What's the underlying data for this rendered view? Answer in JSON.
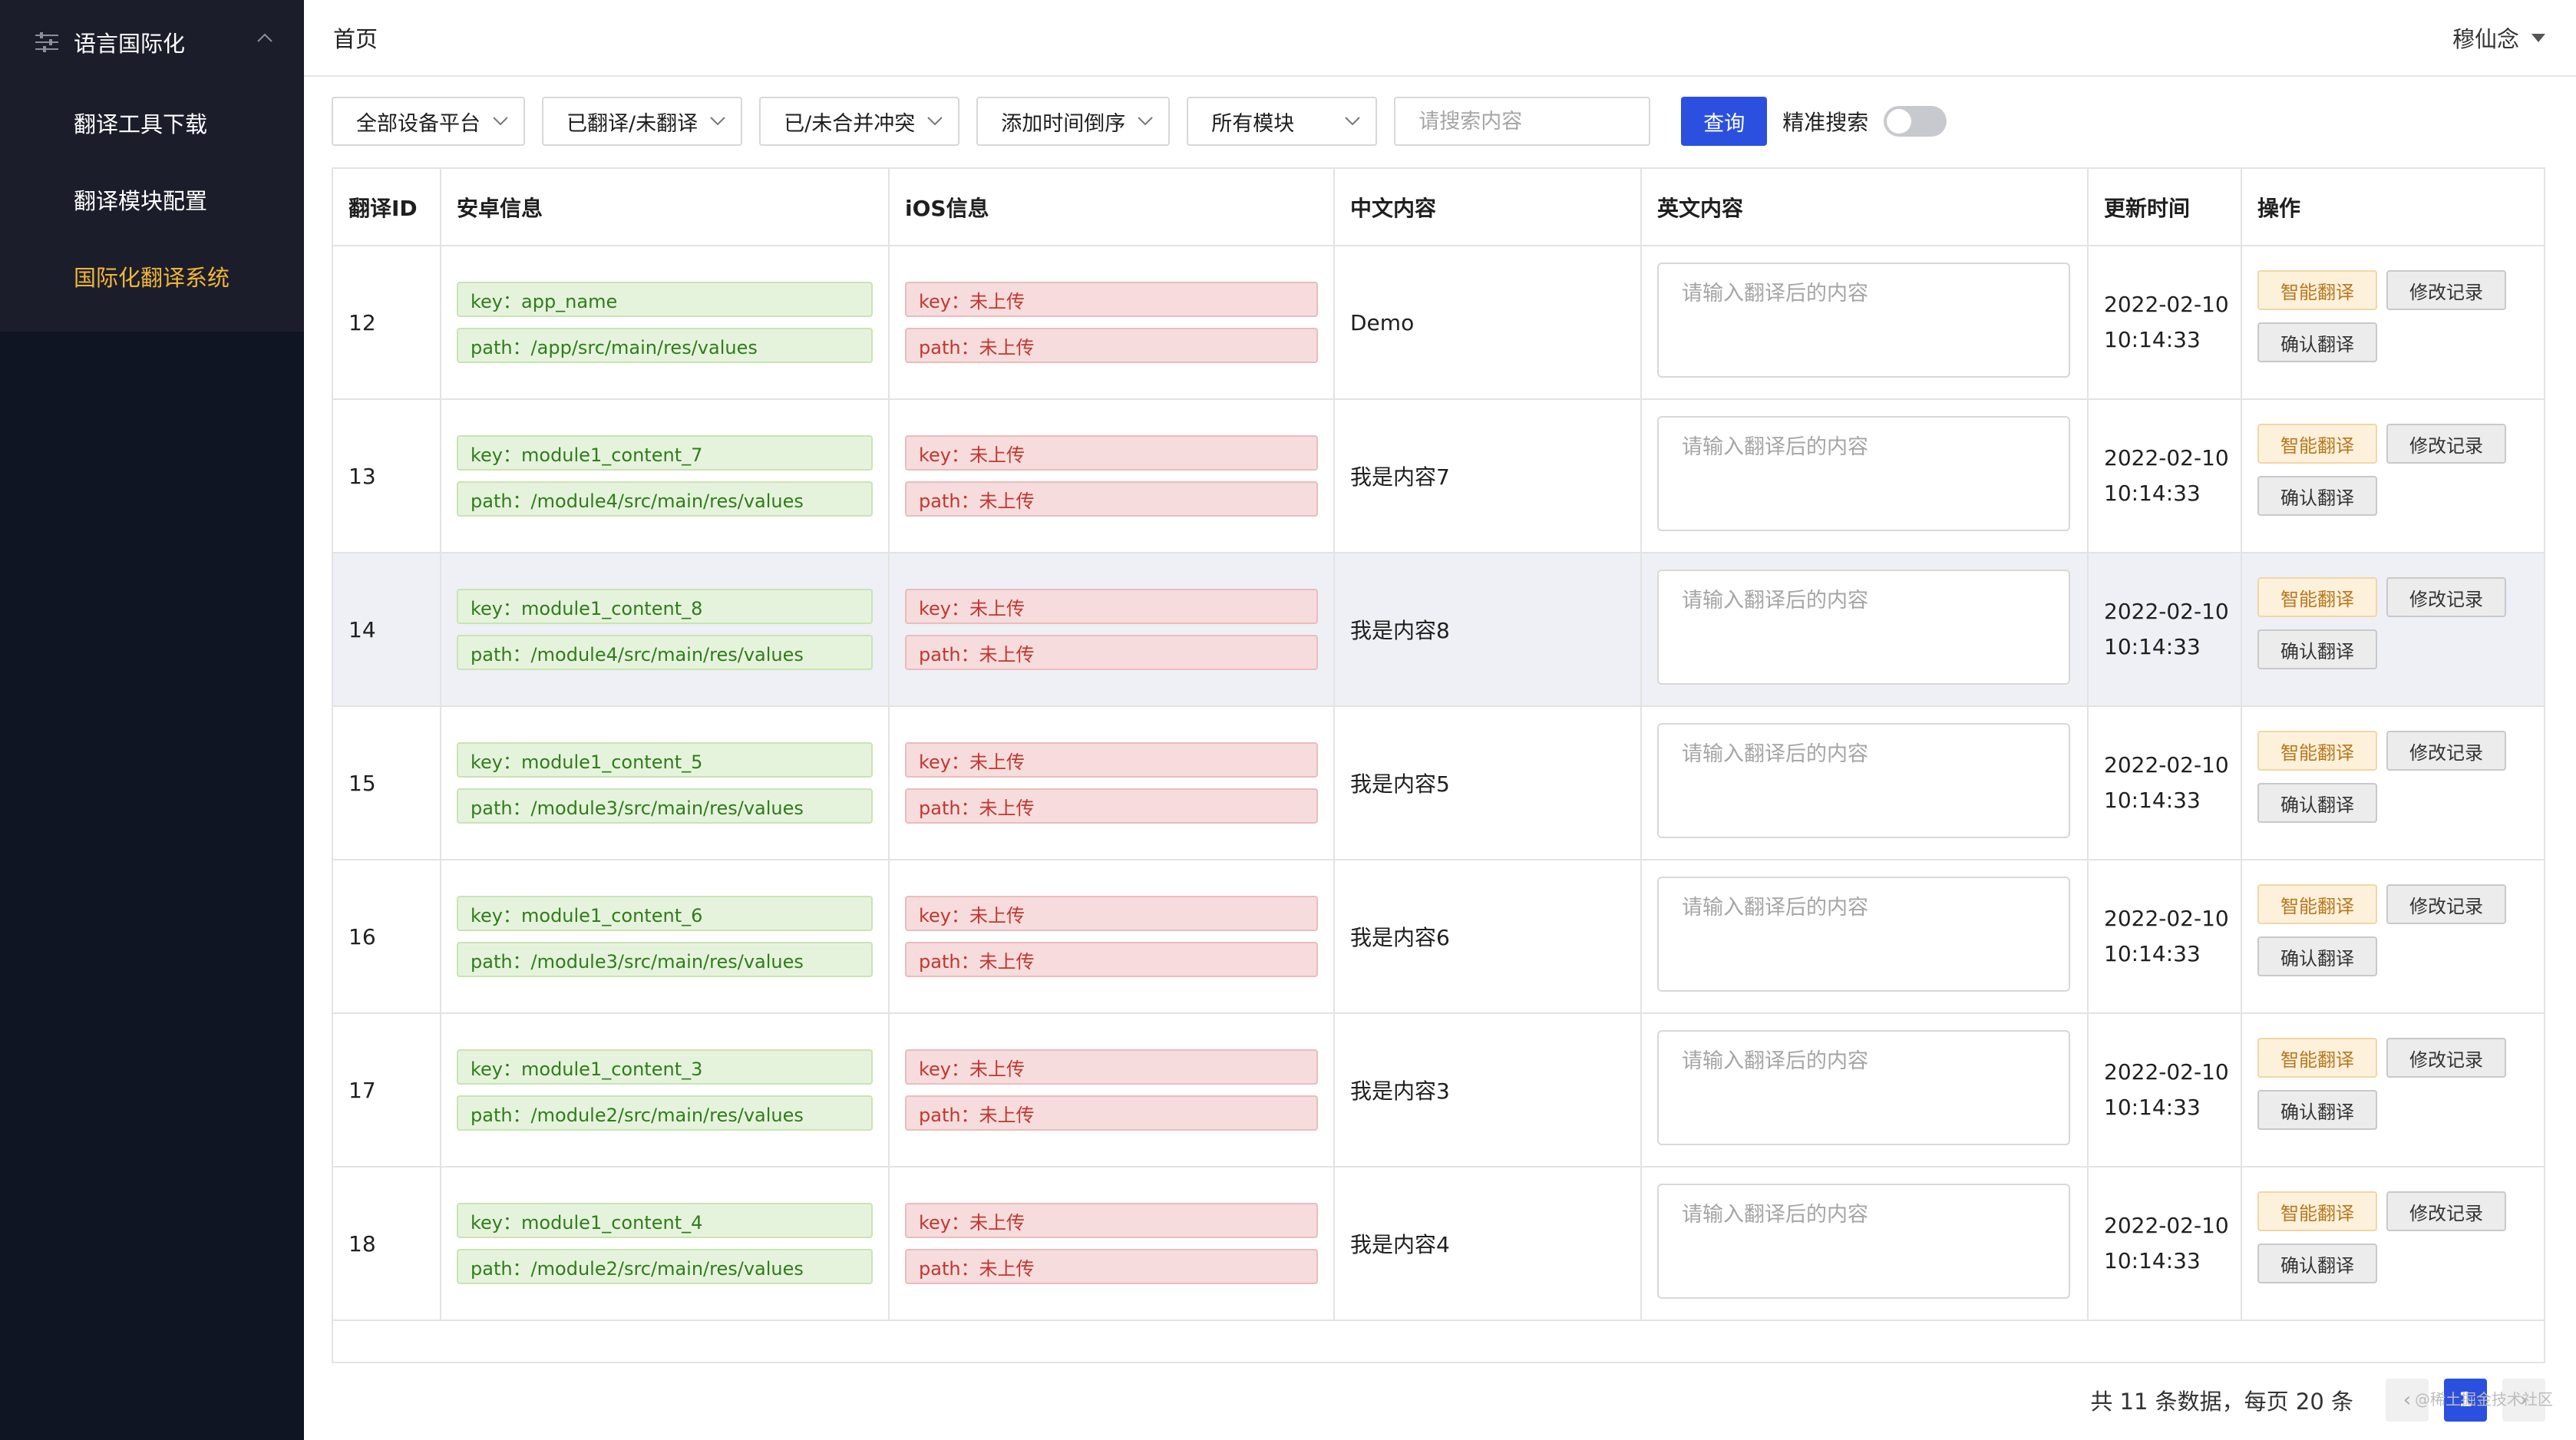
{
  "sidebar": {
    "group_label": "语言国际化",
    "items": [
      {
        "label": "翻译工具下载"
      },
      {
        "label": "翻译模块配置"
      },
      {
        "label": "国际化翻译系统"
      }
    ]
  },
  "topbar": {
    "breadcrumb": "首页",
    "user_name": "穆仙念"
  },
  "filters": {
    "platform": "全部设备平台",
    "translated": "已翻译/未翻译",
    "conflict": "已/未合并冲突",
    "sort": "添加时间倒序",
    "module": "所有模块",
    "search_placeholder": "请搜索内容",
    "query_label": "查询",
    "precise_label": "精准搜索"
  },
  "table": {
    "headers": [
      "翻译ID",
      "安卓信息",
      "iOS信息",
      "中文内容",
      "英文内容",
      "更新时间",
      "操作"
    ],
    "input_placeholder": "请输入翻译后的内容",
    "ios_key": "key：未上传",
    "ios_path": "path：未上传",
    "date": "2022-02-10",
    "time": "10:14:33",
    "btn_smart": "智能翻译",
    "btn_log": "修改记录",
    "btn_confirm": "确认翻译",
    "rows": [
      {
        "id": "12",
        "key": "key：app_name",
        "path": "path：/app/src/main/res/values",
        "zh": "Demo"
      },
      {
        "id": "13",
        "key": "key：module1_content_7",
        "path": "path：/module4/src/main/res/values",
        "zh": "我是内容7"
      },
      {
        "id": "14",
        "key": "key：module1_content_8",
        "path": "path：/module4/src/main/res/values",
        "zh": "我是内容8"
      },
      {
        "id": "15",
        "key": "key：module1_content_5",
        "path": "path：/module3/src/main/res/values",
        "zh": "我是内容5"
      },
      {
        "id": "16",
        "key": "key：module1_content_6",
        "path": "path：/module3/src/main/res/values",
        "zh": "我是内容6"
      },
      {
        "id": "17",
        "key": "key：module1_content_3",
        "path": "path：/module2/src/main/res/values",
        "zh": "我是内容3"
      },
      {
        "id": "18",
        "key": "key：module1_content_4",
        "path": "path：/module2/src/main/res/values",
        "zh": "我是内容4"
      }
    ]
  },
  "pagination": {
    "summary": "共 11 条数据，每页 20 条",
    "current_page": "1",
    "prev": "‹",
    "next": "›"
  },
  "watermark": "@稀土掘金技术社区",
  "colors": {
    "sidebar_bg": "#101523",
    "active_menu": "#f1b53a",
    "primary": "#2b50e0"
  }
}
